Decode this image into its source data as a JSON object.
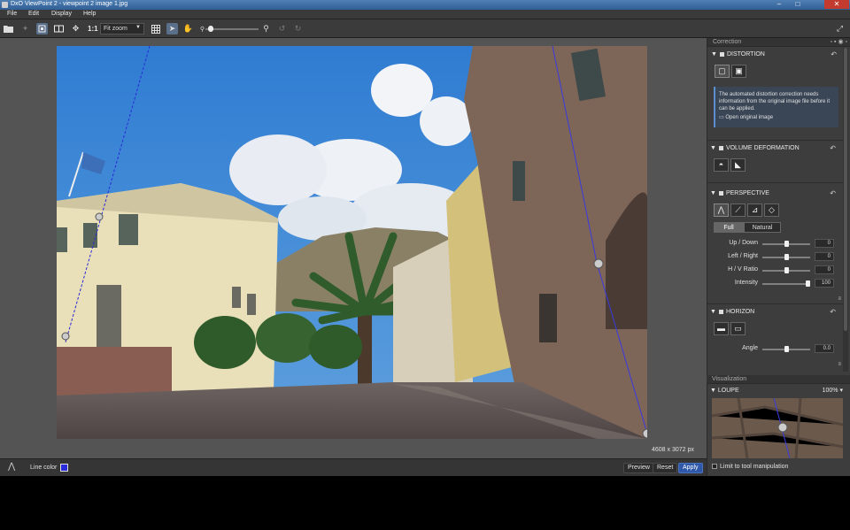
{
  "window": {
    "title": "DxO ViewPoint 2 - viewpoint 2 image 1.jpg"
  },
  "menu": [
    "File",
    "Edit",
    "Display",
    "Help"
  ],
  "toolbar": {
    "one_to_one": "1:1",
    "zoom_select": "Fit zoom",
    "zoom_level": 0.05,
    "icons": [
      "open-folder-icon",
      "grid-icon",
      "hand-icon",
      "zoom-icon",
      "rotate-left-icon",
      "rotate-right-icon"
    ]
  },
  "viewer": {
    "resolution": "4608 x 3072 px"
  },
  "bottom": {
    "line_color_label": "Line color",
    "line_color": "#2a2ad8",
    "preview": "Preview",
    "reset": "Reset",
    "apply": "Apply"
  },
  "panel": {
    "correction_header": "Correction",
    "distortion": {
      "title": "DISTORTION",
      "info": "The automated distortion correction needs information from the original image file before it can be applied.",
      "link": "Open original image"
    },
    "volume": {
      "title": "VOLUME DEFORMATION"
    },
    "perspective": {
      "title": "PERSPECTIVE",
      "modes": [
        "Full",
        "Natural"
      ],
      "sliders": [
        {
          "label": "Up / Down",
          "value": "0",
          "level": 0.5
        },
        {
          "label": "Left / Right",
          "value": "0",
          "level": 0.5
        },
        {
          "label": "H / V Ratio",
          "value": "0",
          "level": 0.5
        },
        {
          "label": "Intensity",
          "value": "100",
          "level": 1.0
        }
      ]
    },
    "horizon": {
      "title": "HORIZON",
      "angle_label": "Angle",
      "angle_value": "0.0",
      "angle_level": 0.5
    },
    "visualization_header": "Visualization",
    "loupe": {
      "title": "LOUPE",
      "zoom": "100%"
    },
    "limit_label": "Limit to tool manipulation"
  }
}
